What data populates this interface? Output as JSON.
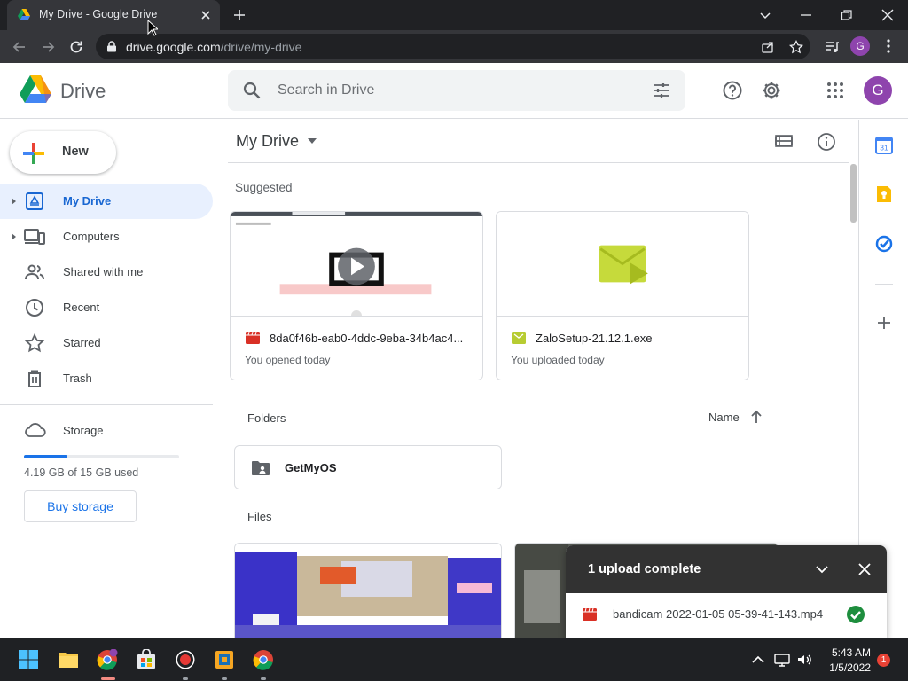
{
  "browser": {
    "tab_title": "My Drive - Google Drive",
    "url_host": "drive.google.com",
    "url_path": "/drive/my-drive",
    "profile_initial": "G"
  },
  "header": {
    "app_name": "Drive",
    "search_placeholder": "Search in Drive",
    "avatar_initial": "G"
  },
  "sidebar": {
    "new_label": "New",
    "items": [
      {
        "label": "My Drive",
        "icon": "my-drive-icon",
        "active": true,
        "expandable": true
      },
      {
        "label": "Computers",
        "icon": "computers-icon",
        "active": false,
        "expandable": true
      },
      {
        "label": "Shared with me",
        "icon": "shared-icon",
        "active": false,
        "expandable": false
      },
      {
        "label": "Recent",
        "icon": "clock-icon",
        "active": false,
        "expandable": false
      },
      {
        "label": "Starred",
        "icon": "star-icon",
        "active": false,
        "expandable": false
      },
      {
        "label": "Trash",
        "icon": "trash-icon",
        "active": false,
        "expandable": false
      }
    ],
    "storage_label": "Storage",
    "storage_used_text": "4.19 GB of 15 GB used",
    "storage_fraction": 0.279,
    "buy_storage_label": "Buy storage"
  },
  "main": {
    "title": "My Drive",
    "suggested_label": "Suggested",
    "suggested": [
      {
        "name": "8da0f46b-eab0-4ddc-9eba-34b4ac4...",
        "sub": "You opened today",
        "type": "video-file-icon"
      },
      {
        "name": "ZaloSetup-21.12.1.exe",
        "sub": "You uploaded today",
        "type": "exe-file-icon"
      }
    ],
    "folders_label": "Folders",
    "sort_label": "Name",
    "folders": [
      {
        "name": "GetMyOS"
      }
    ],
    "files_label": "Files"
  },
  "upload_toast": {
    "title": "1 upload complete",
    "file_name": "bandicam 2022-01-05 05-39-41-143.mp4"
  },
  "taskbar": {
    "time": "5:43 AM",
    "date": "1/5/2022",
    "notification_count": "1"
  },
  "colors": {
    "accent": "#1a73e8",
    "active_nav_bg": "#e8f0fe",
    "avatar": "#8e44ad",
    "toast_header": "#323232",
    "success": "#1e8e3e"
  }
}
